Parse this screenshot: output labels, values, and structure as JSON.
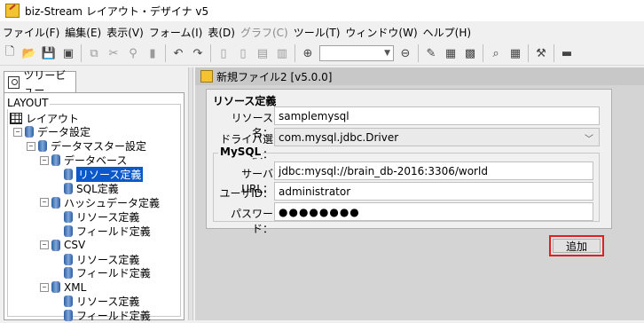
{
  "window": {
    "title": "biz-Stream レイアウト・デザイナ v5"
  },
  "menu": [
    "ファイル(F)",
    "編集(E)",
    "表示(V)",
    "フォーム(I)",
    "表(D)",
    "グラフ(C)",
    "ツール(T)",
    "ウィンドウ(W)",
    "ヘルプ(H)"
  ],
  "toolbar": {
    "icons": [
      "new-file-icon",
      "open-folder-icon",
      "save-icon",
      "save-all-icon",
      "copy-icon",
      "cut-icon",
      "paste-icon",
      "delete-icon",
      "undo-icon",
      "redo-icon",
      "page-icon",
      "page2-icon",
      "page3-icon",
      "page4-icon",
      "zoom-in-icon",
      "zoom-out-icon",
      "edit-icon",
      "table-icon",
      "grid-icon",
      "preview-icon",
      "barcode-icon",
      "tools-icon",
      "form-icon"
    ]
  },
  "left_panel": {
    "tab_label": "ツリービュー",
    "group_title": "LAYOUT",
    "tree": [
      {
        "label": "レイアウト",
        "icon": "grid-icon",
        "depth": 0,
        "expander": ""
      },
      {
        "label": "データ設定",
        "icon": "database-icon",
        "depth": 1,
        "expander": "−"
      },
      {
        "label": "データマスター設定",
        "icon": "database-icon",
        "depth": 2,
        "expander": "−"
      },
      {
        "label": "データベース",
        "icon": "database-icon",
        "depth": 3,
        "expander": "−"
      },
      {
        "label": "リソース定義",
        "icon": "database-icon",
        "depth": 4,
        "expander": "",
        "selected": true
      },
      {
        "label": "SQL定義",
        "icon": "database-icon",
        "depth": 4,
        "expander": ""
      },
      {
        "label": "ハッシュデータ定義",
        "icon": "database-icon",
        "depth": 3,
        "expander": "−"
      },
      {
        "label": "リソース定義",
        "icon": "database-icon",
        "depth": 4,
        "expander": ""
      },
      {
        "label": "フィールド定義",
        "icon": "database-icon",
        "depth": 4,
        "expander": ""
      },
      {
        "label": "CSV",
        "icon": "database-icon",
        "depth": 3,
        "expander": "−"
      },
      {
        "label": "リソース定義",
        "icon": "database-icon",
        "depth": 4,
        "expander": ""
      },
      {
        "label": "フィールド定義",
        "icon": "database-icon",
        "depth": 4,
        "expander": ""
      },
      {
        "label": "XML",
        "icon": "database-icon",
        "depth": 3,
        "expander": "−"
      },
      {
        "label": "リソース定義",
        "icon": "database-icon",
        "depth": 4,
        "expander": ""
      },
      {
        "label": "フィールド定義",
        "icon": "database-icon",
        "depth": 4,
        "expander": ""
      }
    ]
  },
  "document": {
    "title": "新規ファイル2 [v5.0.0]",
    "section_title": "リソース定義",
    "resource_name_label": "リソース名：",
    "resource_name_value": "samplemysql",
    "driver_label": "ドライバ選択：",
    "driver_value": "com.mysql.jdbc.Driver",
    "mysql_title": "MySQL",
    "server_url_label": "サーバURL：",
    "server_url_value": "jdbc:mysql://brain_db-2016:3306/world",
    "user_id_label": "ユーザID：",
    "user_id_value": "administrator",
    "password_label": "パスワード：",
    "password_value": "●●●●●●●●",
    "add_button": "追加"
  }
}
